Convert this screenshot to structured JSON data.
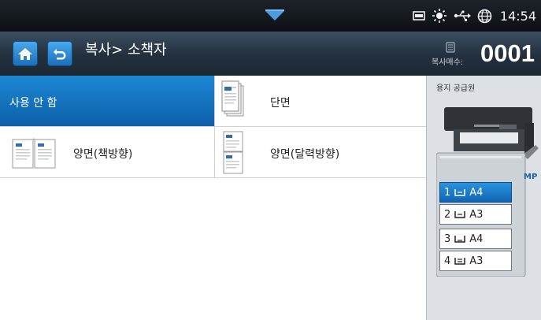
{
  "status_bar": {
    "time": "14:54",
    "icons": [
      "pull-down-arrow-icon",
      "memory-icon",
      "brightness-icon",
      "usb-icon",
      "globe-icon"
    ]
  },
  "title_bar": {
    "title": "복사> 소책자",
    "home_icon": "home-icon",
    "back_icon": "back-icon",
    "copies_label": "복사매수:",
    "copies_value": "0001"
  },
  "options": [
    {
      "label": "사용 안 함",
      "selected": true
    },
    {
      "label": "단면",
      "selected": false
    },
    {
      "label": "양면(책방향)",
      "selected": false
    },
    {
      "label": "양면(달력방향)",
      "selected": false
    }
  ],
  "paper_panel": {
    "title": "용지 공급원",
    "mp_label": "MP",
    "trays": [
      {
        "num": "1",
        "size": "A4",
        "selected": true
      },
      {
        "num": "2",
        "size": "A3",
        "selected": false
      },
      {
        "num": "3",
        "size": "A4",
        "selected": false
      },
      {
        "num": "4",
        "size": "A3",
        "selected": false
      }
    ]
  },
  "colors": {
    "accent": "#1b78c8",
    "header": "#26323f"
  }
}
